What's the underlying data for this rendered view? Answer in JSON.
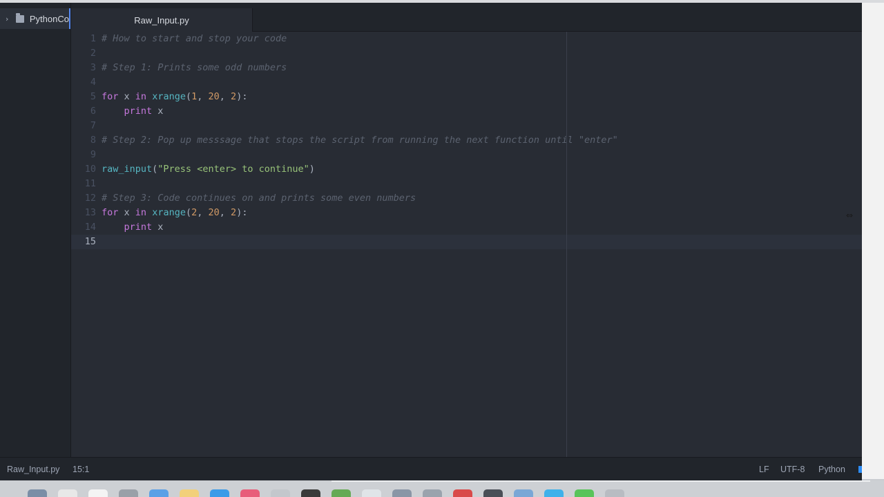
{
  "sidebar": {
    "project_name": "PythonCo",
    "icons": {
      "expand": "chevron-right-icon",
      "folder": "folder-icon"
    }
  },
  "tabs": [
    {
      "label": "Raw_Input.py",
      "active": true
    }
  ],
  "editor": {
    "line_numbers": [
      "1",
      "2",
      "3",
      "4",
      "5",
      "6",
      "7",
      "8",
      "9",
      "10",
      "11",
      "12",
      "13",
      "14",
      "15"
    ],
    "active_line": 15,
    "lines": [
      [
        {
          "t": "# How to start and stop your code",
          "c": "comment"
        }
      ],
      [],
      [
        {
          "t": "# Step 1: Prints some odd numbers",
          "c": "comment"
        }
      ],
      [],
      [
        {
          "t": "for",
          "c": "kw"
        },
        {
          "t": " x ",
          "c": "plain"
        },
        {
          "t": "in",
          "c": "kw"
        },
        {
          "t": " ",
          "c": "plain"
        },
        {
          "t": "xrange",
          "c": "fn"
        },
        {
          "t": "(",
          "c": "plain"
        },
        {
          "t": "1",
          "c": "num"
        },
        {
          "t": ", ",
          "c": "plain"
        },
        {
          "t": "20",
          "c": "num"
        },
        {
          "t": ", ",
          "c": "plain"
        },
        {
          "t": "2",
          "c": "num"
        },
        {
          "t": "):",
          "c": "plain"
        }
      ],
      [
        {
          "t": "    ",
          "c": "plain"
        },
        {
          "t": "print",
          "c": "kw"
        },
        {
          "t": " x",
          "c": "plain"
        }
      ],
      [],
      [
        {
          "t": "# Step 2: Pop up messsage that stops the script from running the next function until \"enter\"",
          "c": "comment"
        }
      ],
      [],
      [
        {
          "t": "raw_input",
          "c": "fn"
        },
        {
          "t": "(",
          "c": "plain"
        },
        {
          "t": "\"Press <enter> to continue\"",
          "c": "str"
        },
        {
          "t": ")",
          "c": "plain"
        }
      ],
      [],
      [
        {
          "t": "# Step 3: Code continues on and prints some even numbers",
          "c": "comment"
        }
      ],
      [
        {
          "t": "for",
          "c": "kw"
        },
        {
          "t": " x ",
          "c": "plain"
        },
        {
          "t": "in",
          "c": "kw"
        },
        {
          "t": " ",
          "c": "plain"
        },
        {
          "t": "xrange",
          "c": "fn"
        },
        {
          "t": "(",
          "c": "plain"
        },
        {
          "t": "2",
          "c": "num"
        },
        {
          "t": ", ",
          "c": "plain"
        },
        {
          "t": "20",
          "c": "num"
        },
        {
          "t": ", ",
          "c": "plain"
        },
        {
          "t": "2",
          "c": "num"
        },
        {
          "t": "):",
          "c": "plain"
        }
      ],
      [
        {
          "t": "    ",
          "c": "plain"
        },
        {
          "t": "print",
          "c": "kw"
        },
        {
          "t": " x",
          "c": "plain"
        }
      ],
      []
    ]
  },
  "statusbar": {
    "file": "Raw_Input.py",
    "cursor": "15:1",
    "line_ending": "LF",
    "encoding": "UTF-8",
    "grammar": "Python"
  },
  "cursor_icon": "resize-horizontal-icon",
  "colors": {
    "background": "#282c34",
    "panel": "#21252b",
    "comment": "#5c6370",
    "keyword": "#c678dd",
    "function": "#56b6c2",
    "number": "#d19a66",
    "string": "#98c379",
    "accent": "#568af2"
  },
  "dock_icons": [
    "finder-icon",
    "safari-icon",
    "calendar-icon",
    "photos-icon",
    "mail-icon",
    "notes-icon",
    "app-store-icon",
    "music-icon",
    "reminders-icon",
    "terminal-icon",
    "atom-icon",
    "chrome-icon",
    "preview-icon",
    "settings-icon",
    "record-icon",
    "screen-icon",
    "folder-icon",
    "messages-icon",
    "facetime-icon",
    "trash-icon"
  ]
}
